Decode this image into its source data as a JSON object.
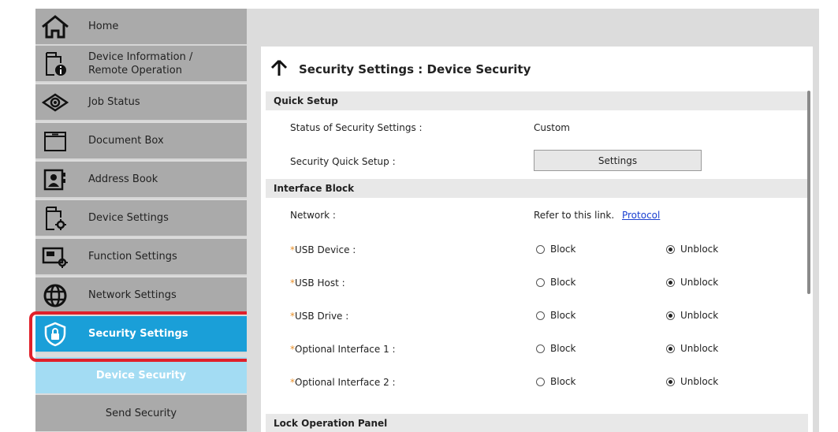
{
  "sidebar": {
    "items": [
      {
        "label": "Home",
        "icon": "home-icon"
      },
      {
        "label": "Device Information /\nRemote Operation",
        "icon": "device-info-icon"
      },
      {
        "label": "Job Status",
        "icon": "eye-icon"
      },
      {
        "label": "Document Box",
        "icon": "folder-icon"
      },
      {
        "label": "Address Book",
        "icon": "address-book-icon"
      },
      {
        "label": "Device Settings",
        "icon": "device-settings-icon"
      },
      {
        "label": "Function Settings",
        "icon": "function-settings-icon"
      },
      {
        "label": "Network Settings",
        "icon": "globe-icon"
      },
      {
        "label": "Security Settings",
        "icon": "shield-lock-icon"
      }
    ],
    "subitems": [
      {
        "label": "Device Security"
      },
      {
        "label": "Send Security"
      }
    ]
  },
  "main": {
    "title": "Security Settings : Device Security",
    "sections": {
      "quick_setup": "Quick Setup",
      "interface_block": "Interface Block",
      "lock_operation_panel": "Lock Operation Panel"
    },
    "quick_setup": {
      "status_label": "Status of Security Settings :",
      "status_value": "Custom",
      "quick_setup_label": "Security Quick Setup :",
      "settings_button": "Settings"
    },
    "interface": {
      "network_label": "Network :",
      "network_text": "Refer to this link.",
      "network_link": "Protocol",
      "block_label": "Block",
      "unblock_label": "Unblock",
      "rows": [
        {
          "label": "USB Device :",
          "selected": "Unblock"
        },
        {
          "label": "USB Host :",
          "selected": "Unblock"
        },
        {
          "label": "USB Drive :",
          "selected": "Unblock"
        },
        {
          "label": "Optional Interface 1 :",
          "selected": "Unblock"
        },
        {
          "label": "Optional Interface 2 :",
          "selected": "Unblock"
        }
      ],
      "required_mark": "*"
    }
  },
  "colors": {
    "active_item": "#1a9fd8",
    "active_subitem": "#a3dcf3",
    "highlight_border": "#e0202a",
    "link": "#1a3fd0"
  }
}
